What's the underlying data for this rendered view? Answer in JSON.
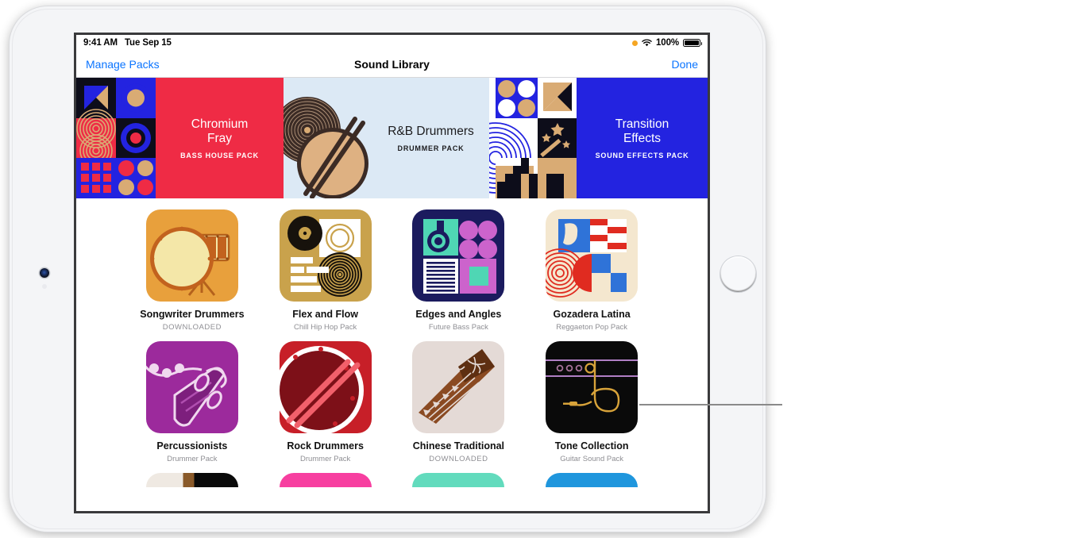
{
  "status_bar": {
    "time": "9:41 AM",
    "date": "Tue Sep 15",
    "recording_indicator": "orange-dot-icon",
    "wifi": "wifi-icon",
    "battery_percent": "100%",
    "battery_icon": "battery-full-icon"
  },
  "nav": {
    "left_button": "Manage Packs",
    "title": "Sound Library",
    "right_button": "Done",
    "accent_color": "#0a74ff"
  },
  "banners": [
    {
      "title_line1": "Chromium",
      "title_line2": "Fray",
      "subtitle": "BASS HOUSE PACK",
      "bg": "#ef2b45",
      "text_color": "#ffffff"
    },
    {
      "title_line1": "R&B Drummers",
      "title_line2": "",
      "subtitle": "DRUMMER PACK",
      "bg": "#dce9f5",
      "text_color": "#1c1c1e"
    },
    {
      "title_line1": "Transition",
      "title_line2": "Effects",
      "subtitle": "SOUND EFFECTS PACK",
      "bg": "#2323e0",
      "text_color": "#ffffff"
    }
  ],
  "packs": [
    {
      "name": "Songwriter Drummers",
      "subtitle": "DOWNLOADED",
      "downloaded": true,
      "art": "songwriter-drummers",
      "bg": "#e8a03c"
    },
    {
      "name": "Flex and Flow",
      "subtitle": "Chill Hip Hop Pack",
      "downloaded": false,
      "art": "flex-and-flow",
      "bg": "#c9a24c"
    },
    {
      "name": "Edges and Angles",
      "subtitle": "Future Bass Pack",
      "downloaded": false,
      "art": "edges-and-angles",
      "bg": "#1b1b5e"
    },
    {
      "name": "Gozadera Latina",
      "subtitle": "Reggaeton Pop Pack",
      "downloaded": false,
      "art": "gozadera-latina",
      "bg": "#f4e7cf"
    },
    {
      "name": "Percussionists",
      "subtitle": "Drummer Pack",
      "downloaded": false,
      "art": "percussionists",
      "bg": "#9c2a9c"
    },
    {
      "name": "Rock Drummers",
      "subtitle": "Drummer Pack",
      "downloaded": false,
      "art": "rock-drummers",
      "bg": "#c71f28"
    },
    {
      "name": "Chinese Traditional",
      "subtitle": "DOWNLOADED",
      "downloaded": true,
      "art": "chinese-traditional",
      "bg": "#e4dad6"
    },
    {
      "name": "Tone Collection",
      "subtitle": "Guitar Sound Pack",
      "downloaded": false,
      "art": "tone-collection",
      "bg": "#0a0a0a"
    }
  ],
  "packs_partial_row": [
    {
      "bg": "#1a1a1a",
      "art": "partial-piano"
    },
    {
      "bg": "#f73fa0",
      "art": "partial-pink"
    },
    {
      "bg": "#62dbbd",
      "art": "partial-teal"
    },
    {
      "bg": "#1f96dd",
      "art": "partial-blue"
    }
  ]
}
